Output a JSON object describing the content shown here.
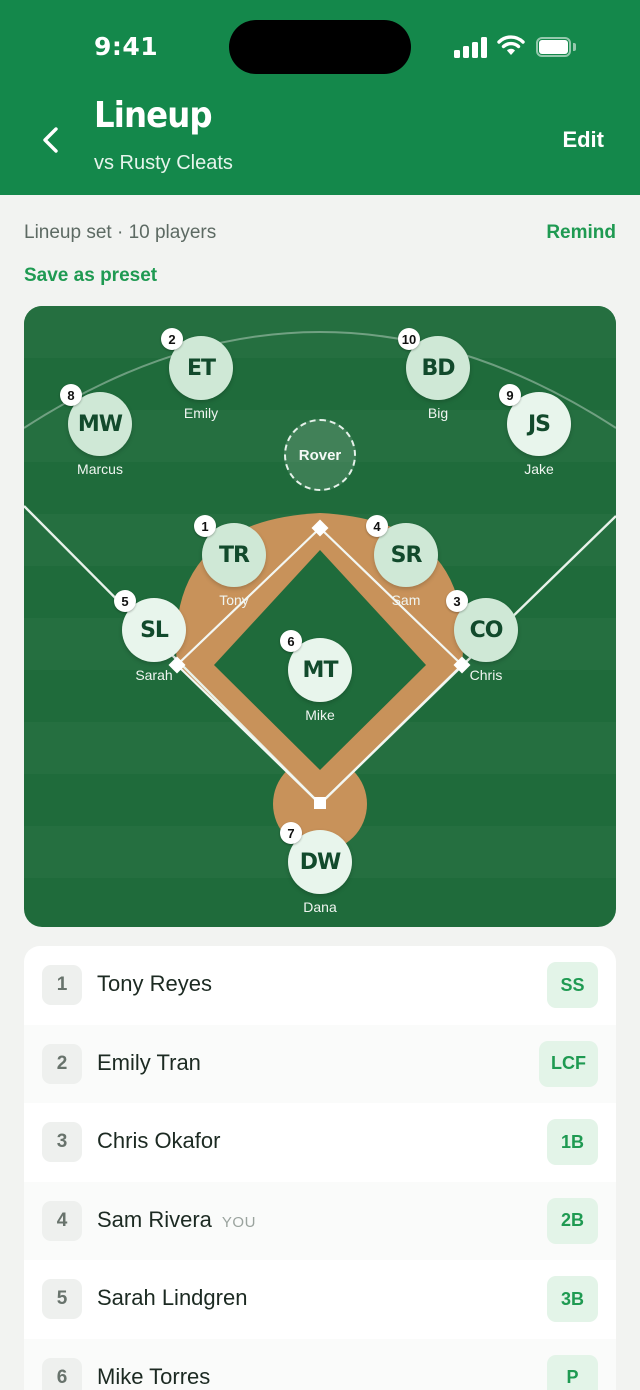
{
  "status_bar": {
    "time": "9:41"
  },
  "header": {
    "title": "Lineup",
    "subtitle": "vs Rusty Cleats",
    "edit_label": "Edit"
  },
  "info": {
    "status": "Lineup set · 10 players",
    "remind_label": "Remind",
    "preset_label": "Save as preset"
  },
  "field": {
    "rover_label": "Rover",
    "players": [
      {
        "order": "2",
        "initials": "ET",
        "name": "Emily"
      },
      {
        "order": "10",
        "initials": "BD",
        "name": "Big"
      },
      {
        "order": "8",
        "initials": "MW",
        "name": "Marcus"
      },
      {
        "order": "9",
        "initials": "JS",
        "name": "Jake"
      },
      {
        "order": "1",
        "initials": "TR",
        "name": "Tony"
      },
      {
        "order": "4",
        "initials": "SR",
        "name": "Sam"
      },
      {
        "order": "5",
        "initials": "SL",
        "name": "Sarah"
      },
      {
        "order": "3",
        "initials": "CO",
        "name": "Chris"
      },
      {
        "order": "6",
        "initials": "MT",
        "name": "Mike"
      },
      {
        "order": "7",
        "initials": "DW",
        "name": "Dana"
      }
    ]
  },
  "lineup": [
    {
      "order": "1",
      "name": "Tony Reyes",
      "tag": "",
      "position": "SS"
    },
    {
      "order": "2",
      "name": "Emily Tran",
      "tag": "",
      "position": "LCF"
    },
    {
      "order": "3",
      "name": "Chris Okafor",
      "tag": "",
      "position": "1B"
    },
    {
      "order": "4",
      "name": "Sam Rivera",
      "tag": "YOU",
      "position": "2B"
    },
    {
      "order": "5",
      "name": "Sarah Lindgren",
      "tag": "",
      "position": "3B"
    },
    {
      "order": "6",
      "name": "Mike Torres",
      "tag": "",
      "position": "P"
    }
  ]
}
